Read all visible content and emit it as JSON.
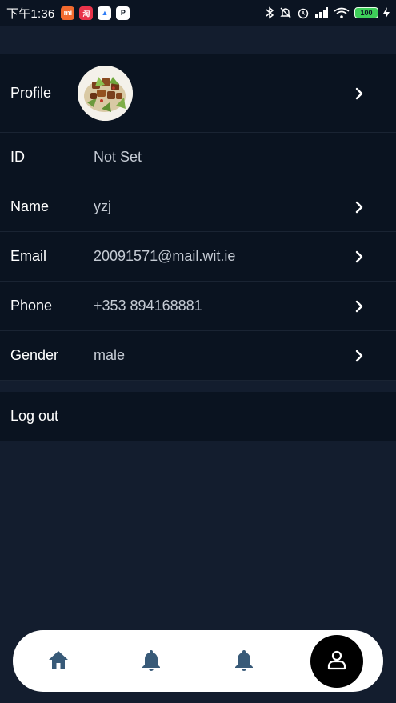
{
  "status_bar": {
    "time": "下午1:36",
    "apps": [
      {
        "name": "mi-app-icon",
        "text": "mi",
        "color": "#f26a2e"
      },
      {
        "name": "taobao-app-icon",
        "text": "淘",
        "color": "#e8334a"
      },
      {
        "name": "drive-app-icon",
        "text": "▲",
        "color": "#ffffff"
      },
      {
        "name": "p-app-icon",
        "text": "P",
        "color": "#0b1422"
      }
    ],
    "battery": "100"
  },
  "profile": {
    "rows": [
      {
        "label": "Profile",
        "value": ""
      },
      {
        "label": "ID",
        "value": "Not Set"
      },
      {
        "label": "Name",
        "value": "yzj"
      },
      {
        "label": "Email",
        "value": "20091571@mail.wit.ie"
      },
      {
        "label": "Phone",
        "value": "+353 894168881"
      },
      {
        "label": "Gender",
        "value": "male"
      }
    ]
  },
  "logout": {
    "label": "Log out"
  },
  "colors": {
    "background": "#131d2e",
    "row_background": "#0a1320",
    "value_text": "#c5cbd4",
    "nav_background": "#ffffff",
    "nav_icon": "#385a78",
    "nav_active": "#000000"
  },
  "nav": {
    "items": [
      {
        "icon": "home-icon",
        "active": false
      },
      {
        "icon": "bell-icon",
        "active": false
      },
      {
        "icon": "bell-icon",
        "active": false
      },
      {
        "icon": "person-icon",
        "active": true
      }
    ]
  }
}
